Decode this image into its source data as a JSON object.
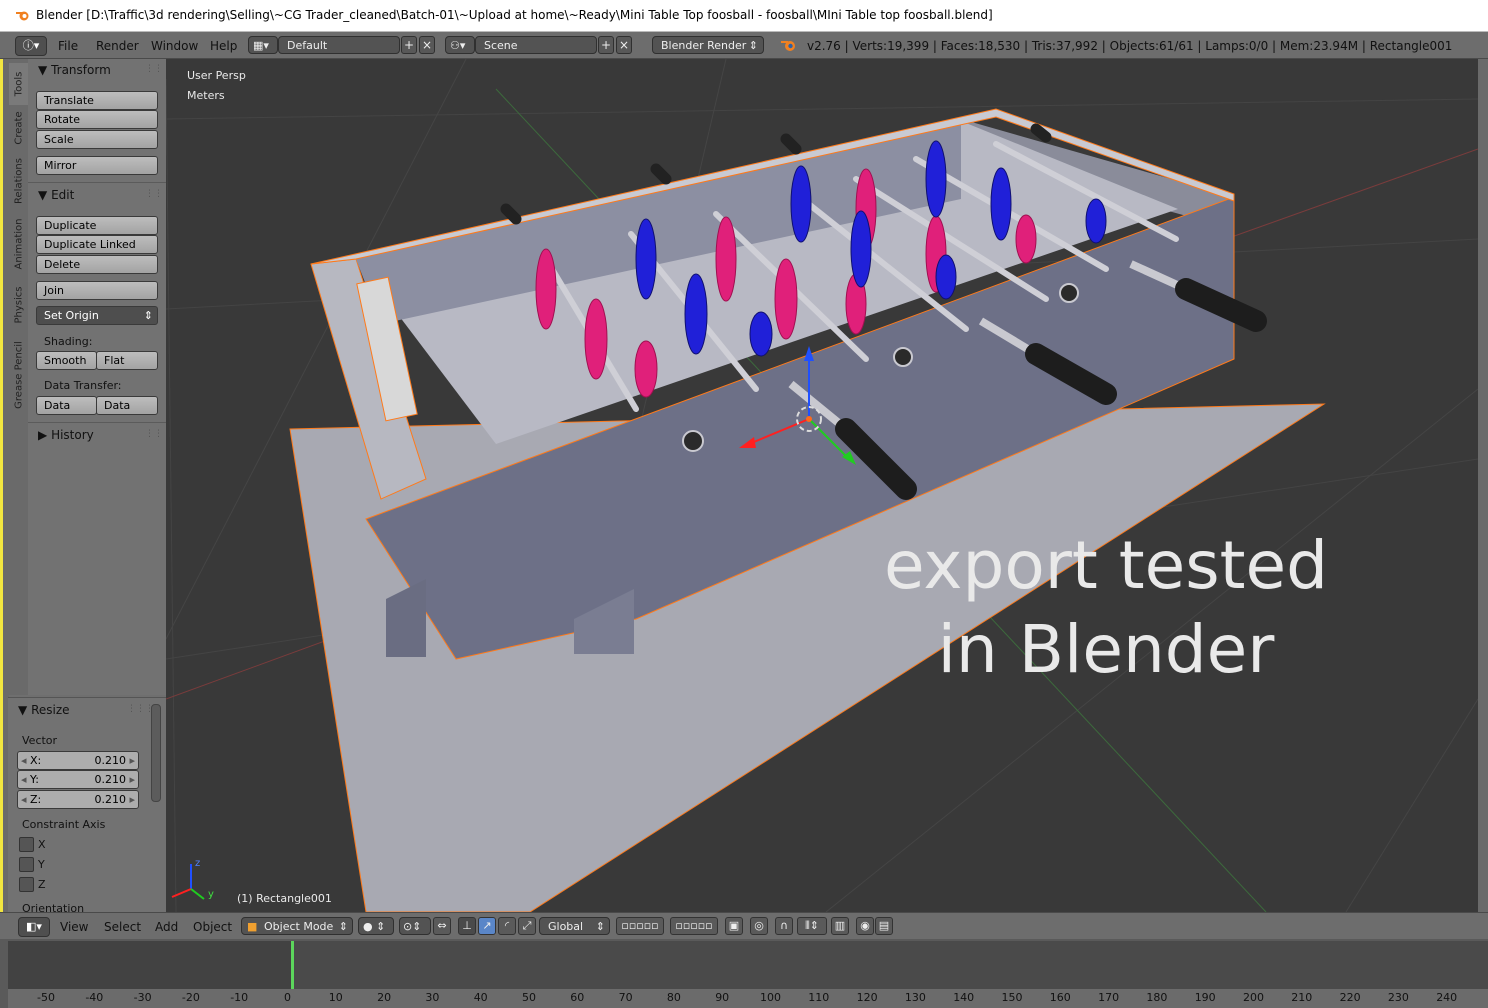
{
  "window": {
    "title": "Blender [D:\\Traffic\\3d rendering\\Selling\\~CG Trader_cleaned\\Batch-01\\~Upload at home\\~Ready\\Mini Table Top  foosball - foosball\\MIni Table top foosball.blend]"
  },
  "info_header": {
    "menus": [
      "File",
      "Render",
      "Window",
      "Help"
    ],
    "layout": "Default",
    "scene": "Scene",
    "render_engine": "Blender Render",
    "stats": "v2.76 | Verts:19,399 | Faces:18,530 | Tris:37,992 | Objects:61/61 | Lamps:0/0 | Mem:23.94M | Rectangle001"
  },
  "tool_tabs": [
    "Tools",
    "Create",
    "Relations",
    "Animation",
    "Physics",
    "Grease Pencil"
  ],
  "tools": {
    "transform_title": "Transform",
    "translate": "Translate",
    "rotate": "Rotate",
    "scale": "Scale",
    "mirror": "Mirror",
    "edit_title": "Edit",
    "duplicate": "Duplicate",
    "duplicate_linked": "Duplicate Linked",
    "delete": "Delete",
    "join": "Join",
    "set_origin": "Set Origin",
    "shading_label": "Shading:",
    "smooth": "Smooth",
    "flat": "Flat",
    "data_transfer_label": "Data Transfer:",
    "data": "Data",
    "data_layout": "Data Layo",
    "history_title": "History"
  },
  "operator": {
    "title": "Resize",
    "vector_label": "Vector",
    "x_label": "X:",
    "x_value": "0.210",
    "y_label": "Y:",
    "y_value": "0.210",
    "z_label": "Z:",
    "z_value": "0.210",
    "constraint_label": "Constraint Axis",
    "cx": "X",
    "cy": "Y",
    "cz": "Z",
    "orientation_label": "Orientation"
  },
  "viewport": {
    "view_name": "User Persp",
    "units": "Meters",
    "object_label": "(1) Rectangle001",
    "watermark_line1": "export tested",
    "watermark_line2": "in Blender",
    "axis_z": "z",
    "axis_y": "y"
  },
  "view3d_header": {
    "menus": [
      "View",
      "Select",
      "Add",
      "Object"
    ],
    "mode": "Object Mode",
    "orientation": "Global"
  },
  "timeline": {
    "current_frame": 0,
    "ticks": [
      "-50",
      "-40",
      "-30",
      "-20",
      "-10",
      "0",
      "10",
      "20",
      "30",
      "40",
      "50",
      "60",
      "70",
      "80",
      "90",
      "100",
      "110",
      "120",
      "130",
      "140",
      "150",
      "160",
      "170",
      "180",
      "190",
      "200",
      "210",
      "220",
      "230",
      "240"
    ]
  },
  "colors": {
    "team_red": "#e0207a",
    "team_blue": "#2020d8",
    "selection": "#ff7a1a",
    "table": "#a9aab4",
    "panel": "#727272"
  }
}
